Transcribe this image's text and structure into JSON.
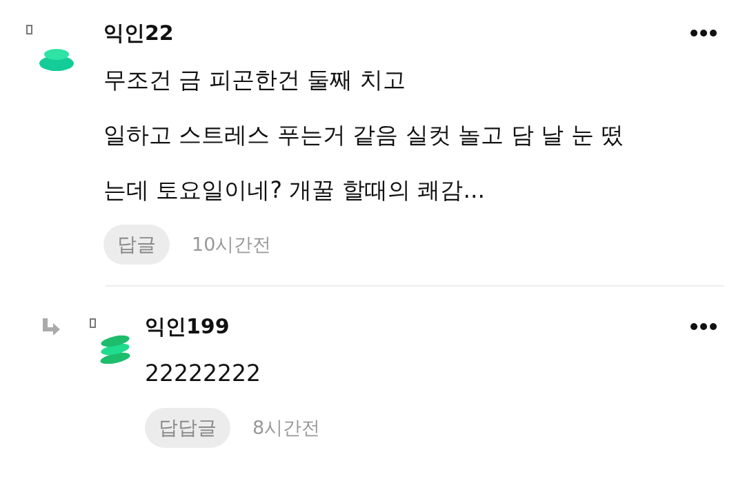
{
  "comments": [
    {
      "kind": "comment",
      "author": "익인22",
      "lines": [
        "무조건 금 피곤한건 둘째 치고",
        "일하고 스트레스 푸는거 같음 실컷 놀고 담 날 눈 떴",
        "는데 토요일이네? 개꿀 할때의 쾌감..."
      ],
      "reply_button": "답글",
      "time": "10시간전"
    },
    {
      "kind": "reply",
      "author": "익인199",
      "lines": [
        "22222222"
      ],
      "reply_button": "답답글",
      "time": "8시간전"
    }
  ]
}
